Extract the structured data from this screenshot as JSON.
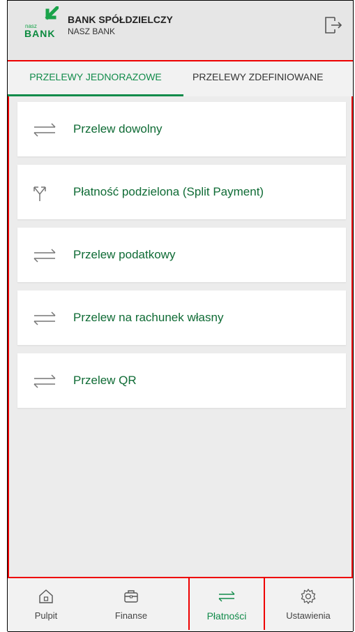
{
  "header": {
    "logo_small": "nasz",
    "logo_big": "BANK",
    "bank_name": "BANK SPÓŁDZIELCZY",
    "bank_subtitle": "NASZ BANK"
  },
  "tabs": [
    {
      "label": "PRZELEWY JEDNORAZOWE",
      "active": true
    },
    {
      "label": "PRZELEWY ZDEFINIOWANE",
      "active": false
    }
  ],
  "items": [
    {
      "label": "Przelew dowolny",
      "icon": "transfer-arrows-icon"
    },
    {
      "label": "Płatność podzielona (Split Payment)",
      "icon": "split-arrows-icon"
    },
    {
      "label": "Przelew podatkowy",
      "icon": "transfer-arrows-icon"
    },
    {
      "label": "Przelew na rachunek własny",
      "icon": "transfer-arrows-icon"
    },
    {
      "label": "Przelew QR",
      "icon": "transfer-arrows-icon"
    }
  ],
  "nav": [
    {
      "label": "Pulpit",
      "icon": "home-icon",
      "active": false
    },
    {
      "label": "Finanse",
      "icon": "briefcase-icon",
      "active": false
    },
    {
      "label": "Płatności",
      "icon": "transfer-arrows-icon",
      "active": true
    },
    {
      "label": "Ustawienia",
      "icon": "gear-icon",
      "active": false
    }
  ],
  "colors": {
    "accent": "#118b4a",
    "highlight": "#e00000",
    "background": "#ececec"
  }
}
